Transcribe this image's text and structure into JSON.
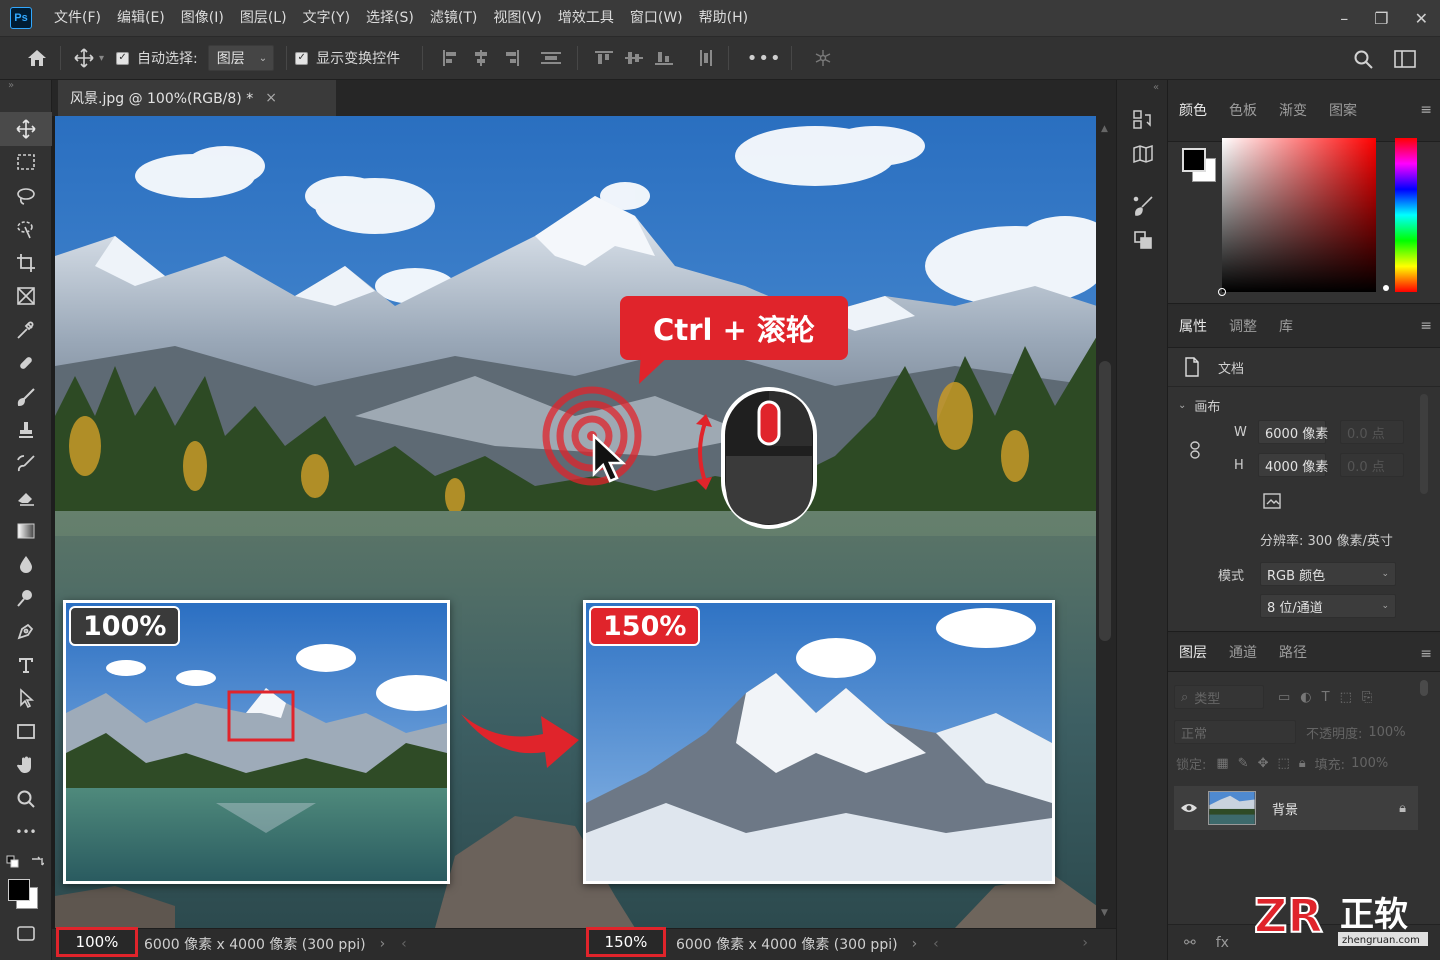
{
  "menubar": {
    "logo": "Ps",
    "items": [
      "文件(F)",
      "编辑(E)",
      "图像(I)",
      "图层(L)",
      "文字(Y)",
      "选择(S)",
      "滤镜(T)",
      "视图(V)",
      "增效工具",
      "窗口(W)",
      "帮助(H)"
    ]
  },
  "options": {
    "auto_select_label": "自动选择:",
    "auto_select_value": "图层",
    "show_transform_label": "显示变换控件"
  },
  "document": {
    "tab_title": "风景.jpg @ 100%(RGB/8) *"
  },
  "overlay": {
    "callout": "Ctrl + 滚轮",
    "left_badge": "100%",
    "right_badge": "150%"
  },
  "status": {
    "zoom_left": "100%",
    "info_left": "6000 像素 x 4000 像素 (300 ppi)",
    "zoom_right": "150%",
    "info_right": "6000 像素 x 4000 像素 (300 ppi)"
  },
  "color_panel": {
    "tabs": [
      "颜色",
      "色板",
      "渐变",
      "图案"
    ],
    "fg_color": "#000000",
    "bg_color": "#ffffff"
  },
  "properties_panel": {
    "tabs": [
      "属性",
      "调整",
      "库"
    ],
    "doc_label": "文档",
    "section": "画布",
    "w_label": "W",
    "w_value": "6000 像素",
    "w_dim": "0.0 点",
    "h_label": "H",
    "h_value": "4000 像素",
    "h_dim": "0.0 点",
    "resolution": "分辨率: 300 像素/英寸",
    "mode_label": "模式",
    "mode_value": "RGB 颜色",
    "depth_value": "8 位/通道"
  },
  "layers_panel": {
    "tabs": [
      "图层",
      "通道",
      "路径"
    ],
    "filter_placeholder": "类型",
    "blend_mode": "正常",
    "opacity_label": "不透明度:",
    "opacity_value": "100%",
    "lock_label": "锁定:",
    "fill_label": "填充:",
    "fill_value": "100%",
    "layer_name": "背景"
  },
  "watermark": {
    "logo": "ZR",
    "name": "正软",
    "url": "zhengruan.com"
  },
  "accent": "#e0242b"
}
